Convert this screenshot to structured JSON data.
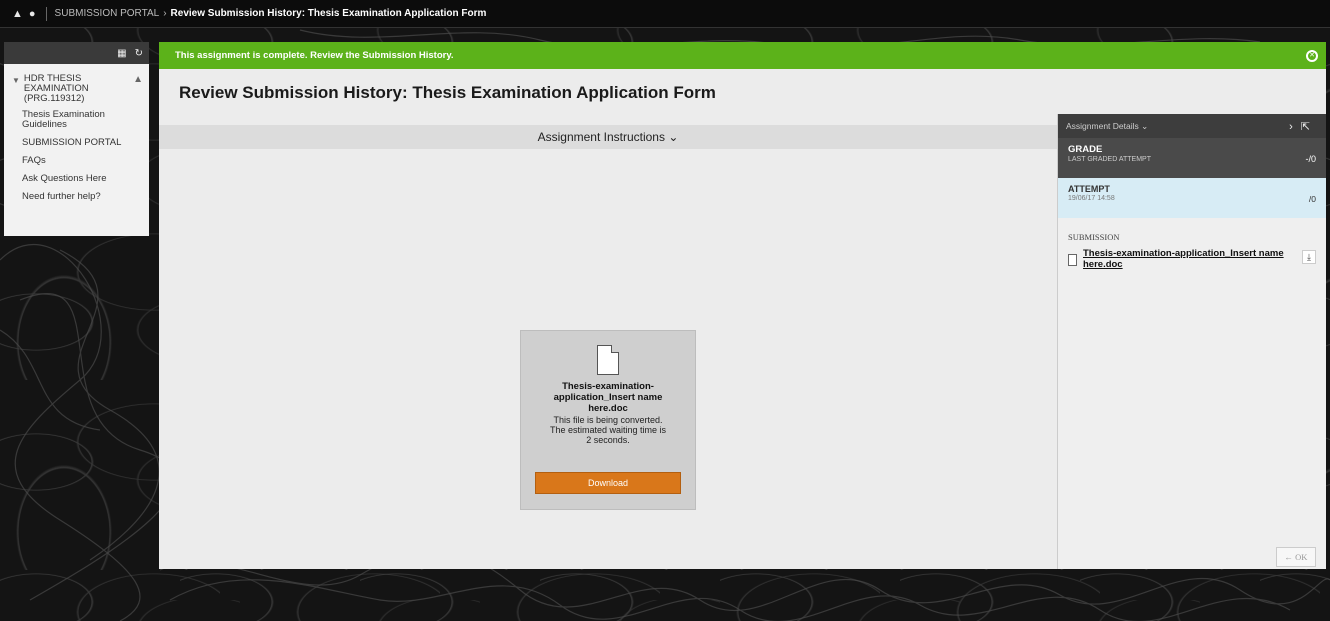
{
  "breadcrumb": {
    "home_icon": "home-icon",
    "globe_icon": "globe-icon",
    "portal": "SUBMISSION PORTAL",
    "arrow": "›",
    "current": "Review Submission History: Thesis Examination Application Form"
  },
  "course_menu": {
    "course_title": "HDR THESIS EXAMINATION (PRG.119312)",
    "items": [
      {
        "label": "Thesis Examination Guidelines"
      },
      {
        "label": "SUBMISSION PORTAL"
      },
      {
        "label": "FAQs"
      },
      {
        "label": "Ask Questions Here"
      },
      {
        "label": "Need further help?"
      }
    ]
  },
  "banner": {
    "message": "This assignment is complete. Review the Submission History.",
    "color": "#5cb21a"
  },
  "page": {
    "title": "Review Submission History: Thesis Examination Application Form",
    "instructions_toggle": "Assignment Instructions"
  },
  "file_preview": {
    "file_name": "Thesis-examination-application_Insert name here.doc",
    "status": "This file is being converted. The estimated waiting time is 2 seconds.",
    "download_label": "Download",
    "accent": "#d9771a"
  },
  "details_panel": {
    "header": "Assignment Details",
    "grade": {
      "label": "GRADE",
      "sublabel": "LAST GRADED ATTEMPT",
      "value": "-/0"
    },
    "attempt": {
      "label": "ATTEMPT",
      "date": "19/06/17 14:58",
      "value": "/0"
    },
    "submission": {
      "label": "SUBMISSION",
      "file": "Thesis-examination-application_Insert name here.doc"
    },
    "ok_label": "← OK"
  }
}
